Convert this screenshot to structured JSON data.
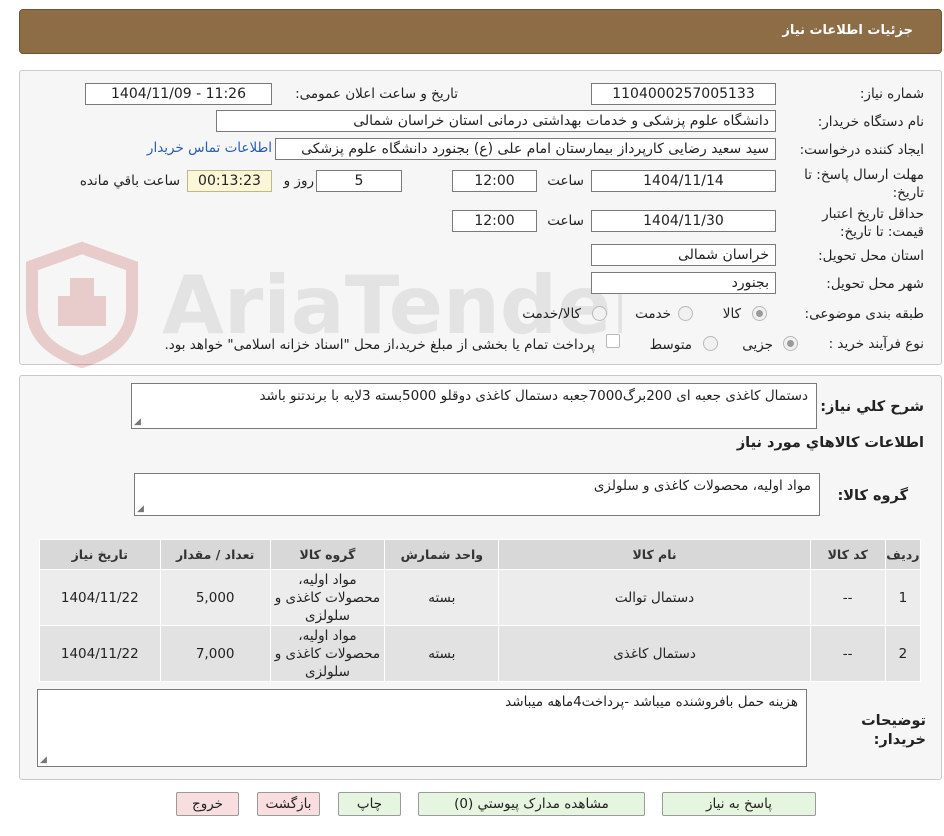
{
  "header": {
    "title": "جزئیات اطلاعات نیاز"
  },
  "form": {
    "need_number_label": "شماره نیاز:",
    "need_number": "1104000257005133",
    "announce_label": "تاریخ و ساعت اعلان عمومی:",
    "announce_value": "1404/11/09 - 11:26",
    "buyer_org_label": "نام دستگاه خریدار:",
    "buyer_org": "دانشگاه علوم پزشکی و خدمات بهداشتی درمانی استان خراسان شمالی",
    "creator_label": "ایجاد کننده درخواست:",
    "creator": "سید سعید رضایی کارپرداز بیمارستان امام علی (ع) بجنورد دانشگاه علوم پزشکی",
    "contact_link": "اطلاعات تماس خریدار",
    "deadline_label": "مهلت ارسال پاسخ: تا تاریخ:",
    "deadline_date": "1404/11/14",
    "hour_label": "ساعت",
    "deadline_time": "12:00",
    "days_value": "5",
    "day_and_label": "روز و",
    "remaining_time": "00:13:23",
    "remaining_label": "ساعت باقي مانده",
    "price_validity_label": "حداقل تاریخ اعتبار قیمت: تا تاریخ:",
    "price_validity_date": "1404/11/30",
    "price_validity_time": "12:00",
    "province_label": "استان محل تحویل:",
    "province": "خراسان شمالی",
    "city_label": "شهر محل تحویل:",
    "city": "بجنورد",
    "category_label": "طبقه بندی موضوعی:",
    "category_options": [
      "کالا",
      "خدمت",
      "کالا/خدمت"
    ],
    "process_label": "نوع فرآیند خرید :",
    "process_options": [
      "جزیی",
      "متوسط"
    ],
    "payment_note": "پرداخت تمام یا بخشی از مبلغ خرید،از محل \"اسناد خزانه اسلامی\" خواهد بود."
  },
  "description": {
    "label": "شرح کلي نياز:",
    "text": "دستمال کاغذی جعبه ای 200برگ7000جعبه  دستمال کاغذی دوقلو 5000بسته 3لایه با برندتنو باشد"
  },
  "goods": {
    "section_title": "اطلاعات کالاهاي مورد نياز",
    "group_label": "گروه کالا:",
    "group_value": "مواد اولیه، محصولات کاغذی و سلولزی",
    "table": {
      "headers": [
        "رديف",
        "کد کالا",
        "نام کالا",
        "واحد شمارش",
        "گروه کالا",
        "تعداد / مقدار",
        "تاريخ نياز"
      ],
      "rows": [
        [
          "1",
          "--",
          "دستمال توالت",
          "بسته",
          "مواد اولیه، محصولات کاغذی و سلولزی",
          "5,000",
          "1404/11/22"
        ],
        [
          "2",
          "--",
          "دستمال کاغذی",
          "بسته",
          "مواد اولیه، محصولات کاغذی و سلولزی",
          "7,000",
          "1404/11/22"
        ]
      ]
    }
  },
  "buyer_notes": {
    "label": "توضیحات خریدار:",
    "text": "هزینه حمل بافروشنده میباشد -پرداخت4ماهه میباشد"
  },
  "buttons": {
    "reply": "پاسخ به نياز",
    "attachments": "مشاهده مدارک پیوستي (0)",
    "print": "چاپ",
    "back": "بازگشت",
    "exit": "خروج"
  },
  "watermark": {
    "text": "AriaTender.neT"
  },
  "colors": {
    "header": "#8c6d46",
    "link": "#2a5db0",
    "green_button": "#e6f5e0",
    "pink_button": "#f8dede"
  }
}
